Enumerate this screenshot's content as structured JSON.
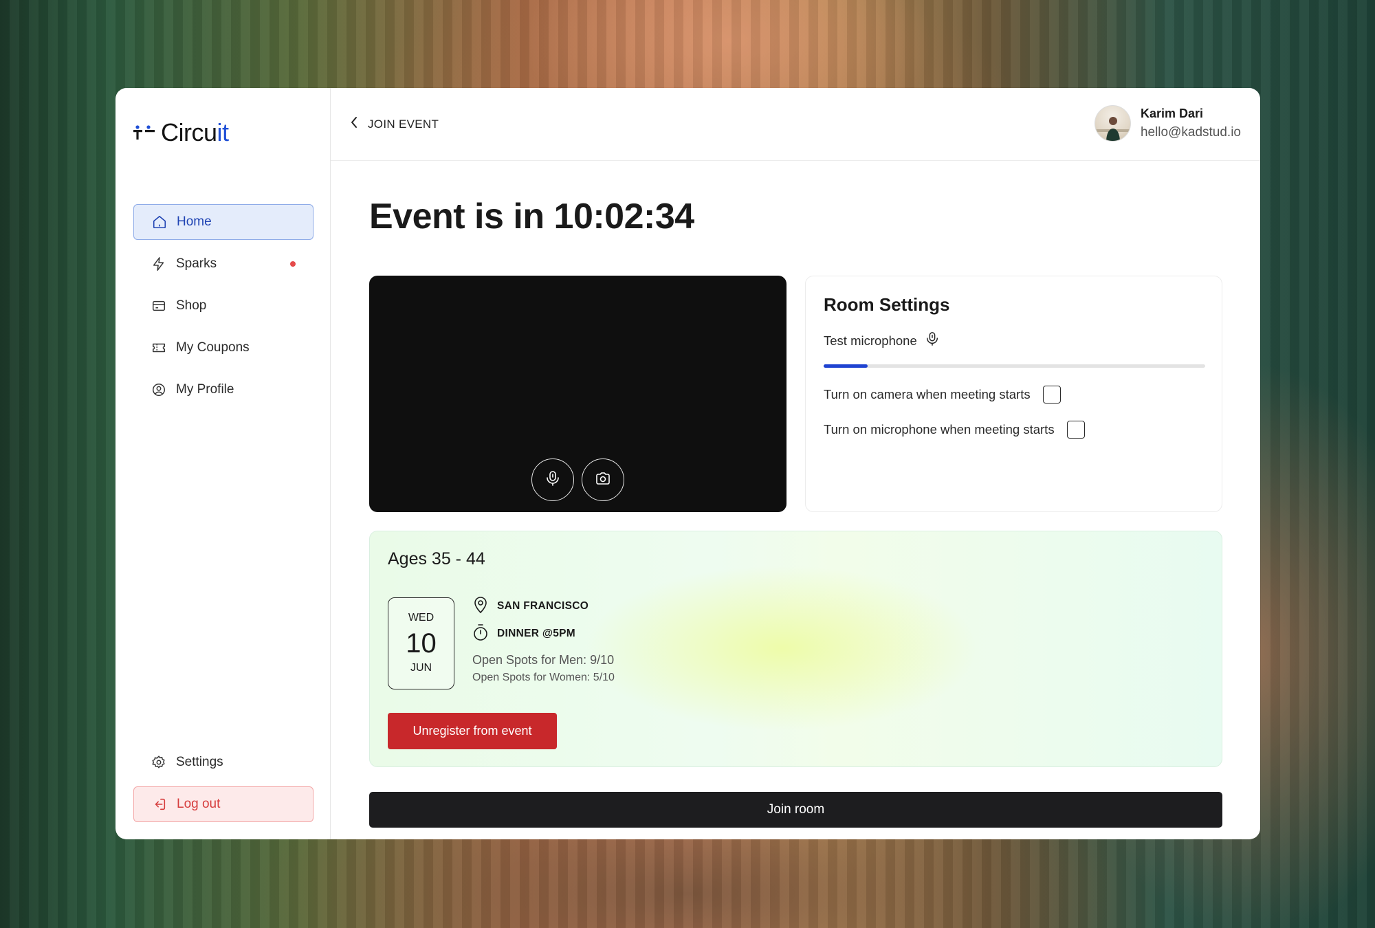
{
  "app": {
    "logo_text": "Circuit",
    "brand_color": "#1f4fd6"
  },
  "sidebar": {
    "items": [
      {
        "label": "Home",
        "icon": "home-icon",
        "active": true
      },
      {
        "label": "Sparks",
        "icon": "bolt-icon",
        "notification": true
      },
      {
        "label": "Shop",
        "icon": "card-icon"
      },
      {
        "label": "My Coupons",
        "icon": "ticket-icon"
      },
      {
        "label": "My Profile",
        "icon": "user-circle-icon"
      }
    ],
    "settings_label": "Settings",
    "logout_label": "Log out"
  },
  "header": {
    "back_label": "JOIN EVENT",
    "user": {
      "name": "Karim Dari",
      "email": "hello@kadstud.io"
    }
  },
  "main": {
    "title": "Event is in 10:02:34",
    "video": {
      "buttons": [
        "microphone-icon",
        "camera-icon"
      ]
    },
    "room_settings": {
      "title": "Room Settings",
      "test_microphone_label": "Test microphone",
      "mic_level": 0.115,
      "options": [
        {
          "label": "Turn on camera when meeting starts",
          "checked": false
        },
        {
          "label": "Turn on microphone when meeting starts",
          "checked": false
        }
      ]
    },
    "event": {
      "title": "Ages 35 - 44",
      "date": {
        "dow": "WED",
        "day": "10",
        "month": "JUN"
      },
      "location": "SAN FRANCISCO",
      "meal": "DINNER @5PM",
      "spots_men": "Open Spots for Men: 9/10",
      "spots_women": "Open Spots for Women: 5/10",
      "unregister_label": "Unregister from event"
    },
    "join_label": "Join room"
  },
  "colors": {
    "accent": "#1f43b3",
    "danger": "#c8282b",
    "notification_dot": "#e54a4a",
    "join_button": "#1d1d1f"
  }
}
